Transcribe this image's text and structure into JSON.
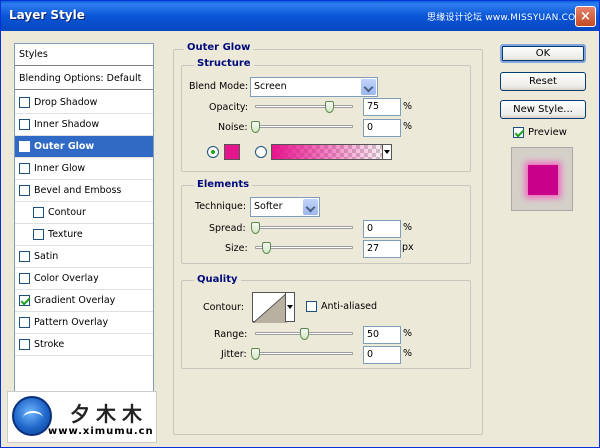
{
  "window": {
    "title": "Layer Style",
    "watermark": "思缘设计论坛 www.MISSYUAN.COM",
    "close": "×"
  },
  "styles_list": {
    "header": "Styles",
    "blending": "Blending Options: Default",
    "items": [
      {
        "label": "Drop Shadow",
        "checked": false,
        "selected": false
      },
      {
        "label": "Inner Shadow",
        "checked": false,
        "selected": false
      },
      {
        "label": "Outer Glow",
        "checked": true,
        "selected": true
      },
      {
        "label": "Inner Glow",
        "checked": false,
        "selected": false
      },
      {
        "label": "Bevel and Emboss",
        "checked": false,
        "selected": false
      },
      {
        "label": "Contour",
        "checked": false,
        "selected": false
      },
      {
        "label": "Texture",
        "checked": false,
        "selected": false
      },
      {
        "label": "Satin",
        "checked": false,
        "selected": false
      },
      {
        "label": "Color Overlay",
        "checked": false,
        "selected": false
      },
      {
        "label": "Gradient Overlay",
        "checked": true,
        "selected": false
      },
      {
        "label": "Pattern Overlay",
        "checked": false,
        "selected": false
      },
      {
        "label": "Stroke",
        "checked": false,
        "selected": false
      }
    ]
  },
  "outer_glow": {
    "title": "Outer Glow",
    "structure": {
      "title": "Structure",
      "blend_mode_label": "Blend Mode:",
      "blend_mode_value": "Screen",
      "opacity_label": "Opacity:",
      "opacity_value": "75",
      "opacity_fraction": 0.75,
      "noise_label": "Noise:",
      "noise_value": "0",
      "noise_fraction": 0,
      "percent": "%",
      "glow_color": "#e6148d",
      "color_mode": "solid"
    },
    "elements": {
      "title": "Elements",
      "technique_label": "Technique:",
      "technique_value": "Softer",
      "spread_label": "Spread:",
      "spread_value": "0",
      "spread_fraction": 0,
      "size_label": "Size:",
      "size_value": "27",
      "size_fraction": 0.11,
      "percent": "%",
      "px": "px"
    },
    "quality": {
      "title": "Quality",
      "contour_label": "Contour:",
      "anti_aliased_label": "Anti-aliased",
      "anti_aliased": false,
      "range_label": "Range:",
      "range_value": "50",
      "range_fraction": 0.5,
      "jitter_label": "Jitter:",
      "jitter_value": "0",
      "jitter_fraction": 0,
      "percent": "%"
    }
  },
  "buttons": {
    "ok": "OK",
    "reset": "Reset",
    "new_style": "New Style...",
    "preview_label": "Preview",
    "preview_checked": true
  },
  "logo": {
    "cn": "夕木木",
    "url": "www.ximumu.cn"
  }
}
